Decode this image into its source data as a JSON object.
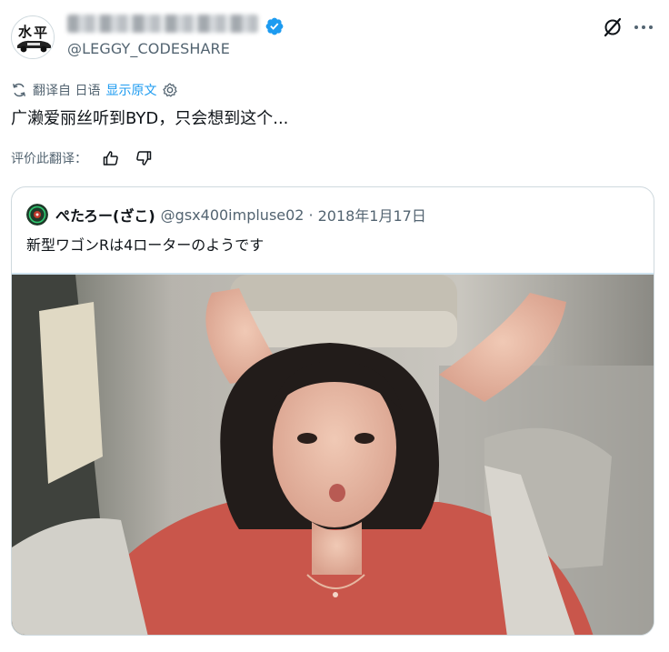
{
  "tweet": {
    "author_handle": "@LEGGY_CODESHARE",
    "translation": {
      "label": "翻译自 日语",
      "show_original": "显示原文"
    },
    "text": "广濑爱丽丝听到BYD，只会想到这个...",
    "rate_label": "评价此翻译：",
    "icons": [
      "translate-icon",
      "gear-icon",
      "thumbs-up-icon",
      "thumbs-down-icon",
      "grok-icon",
      "more-icon",
      "verified-icon"
    ],
    "colors": {
      "accent": "#1d9bf0",
      "secondary_text": "#536471",
      "border": "#cfd9de"
    }
  },
  "quote": {
    "author_name": "ぺたろー(ざこ)",
    "author_handle": "@gsx400impluse02",
    "separator": "·",
    "date": "2018年1月17日",
    "text": "新型ワゴンRは4ローターのようです"
  }
}
